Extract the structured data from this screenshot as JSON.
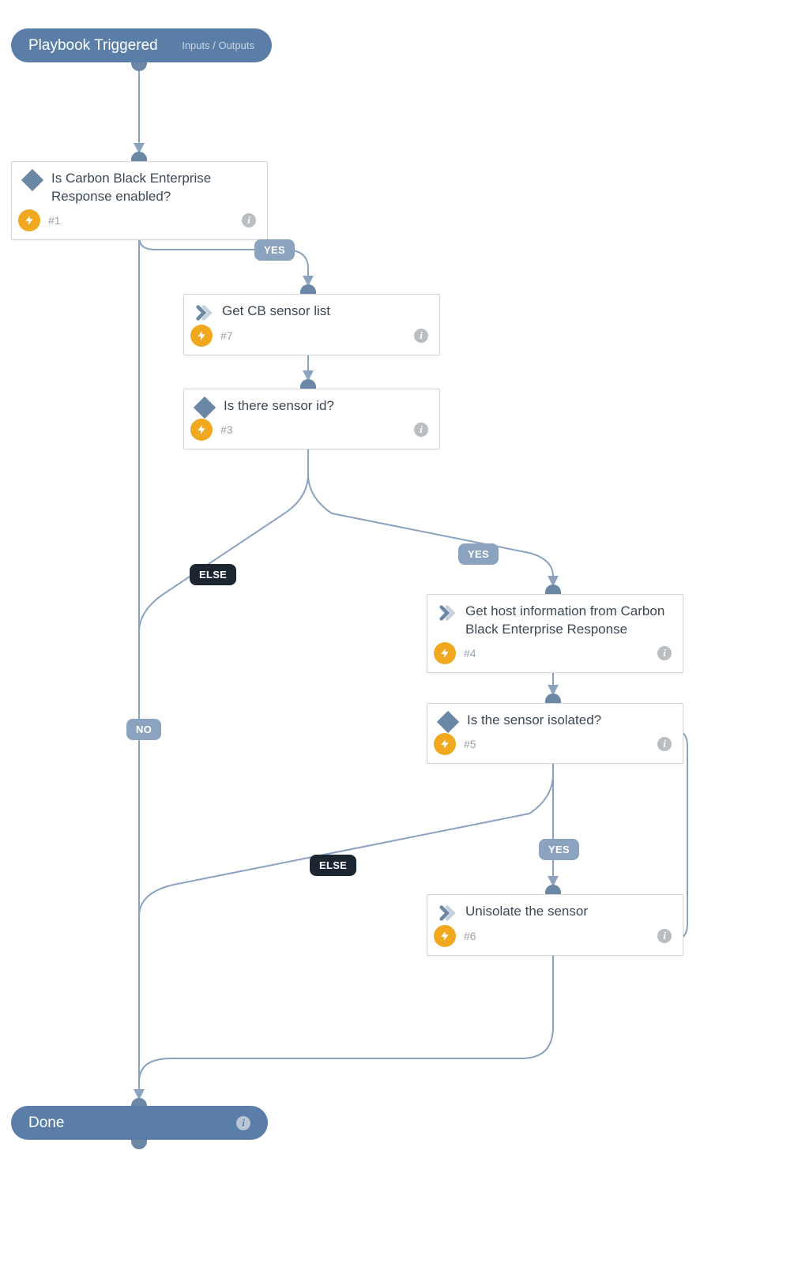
{
  "start": {
    "label": "Playbook Triggered",
    "sublabel": "Inputs / Outputs"
  },
  "end": {
    "label": "Done"
  },
  "nodes": {
    "n1": {
      "title": "Is Carbon Black Enterprise Response enabled?",
      "num": "#1",
      "type": "condition"
    },
    "n7": {
      "title": "Get CB sensor list",
      "num": "#7",
      "type": "action"
    },
    "n3": {
      "title": "Is there sensor id?",
      "num": "#3",
      "type": "condition"
    },
    "n4": {
      "title": "Get host information from Carbon Black Enterprise Response",
      "num": "#4",
      "type": "action"
    },
    "n5": {
      "title": "Is the sensor isolated?",
      "num": "#5",
      "type": "condition"
    },
    "n6": {
      "title": "Unisolate the sensor",
      "num": "#6",
      "type": "action"
    }
  },
  "labels": {
    "yes": "YES",
    "no": "NO",
    "else": "ELSE"
  }
}
